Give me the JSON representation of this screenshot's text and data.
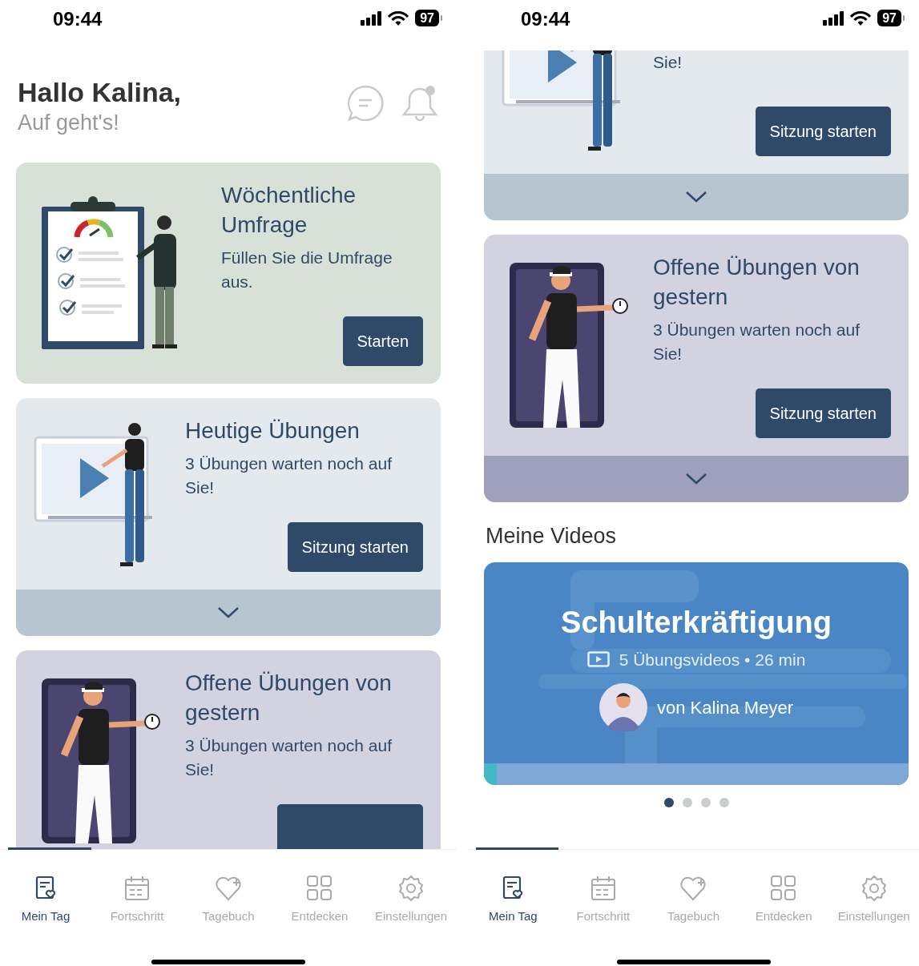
{
  "screens": [
    {
      "status_bar": {
        "time": "09:44",
        "battery": "97"
      },
      "greeting": {
        "title": "Hallo Kalina,",
        "subtitle": "Auf geht's!"
      },
      "cards": [
        {
          "kind": "survey",
          "title": "Wöchentliche Umfrage",
          "text": "Füllen Sie die Umfrage aus.",
          "button": "Starten",
          "expandable": false
        },
        {
          "kind": "today",
          "title": "Heutige Übungen",
          "text": "3 Übungen warten noch auf Sie!",
          "button": "Sitzung starten",
          "expandable": true
        },
        {
          "kind": "open",
          "title": "Offene Übungen von gestern",
          "text": "3 Übungen warten noch auf Sie!",
          "button_cut": true,
          "expandable": false
        }
      ],
      "tabs": [
        {
          "label": "Mein Tag",
          "selected": true
        },
        {
          "label": "Fortschritt",
          "selected": false
        },
        {
          "label": "Tagebuch",
          "selected": false
        },
        {
          "label": "Entdecken",
          "selected": false
        },
        {
          "label": "Einstellungen",
          "selected": false
        }
      ]
    },
    {
      "status_bar": {
        "time": "09:44",
        "battery": "97"
      },
      "cards": [
        {
          "kind": "today",
          "cut_top": true,
          "text": "Sie!",
          "button": "Sitzung starten",
          "expandable": true
        },
        {
          "kind": "open",
          "title": "Offene Übungen von gestern",
          "text": "3 Übungen warten noch auf Sie!",
          "button": "Sitzung starten",
          "expandable": true
        }
      ],
      "section_title": "Meine Videos",
      "video": {
        "title": "Schulterkräftigung",
        "meta": "5 Übungsvideos • 26 min",
        "author": "von Kalina Meyer",
        "level": 0.03
      },
      "pages": [
        {
          "selected": true
        },
        {
          "selected": false
        },
        {
          "selected": false
        },
        {
          "selected": false
        }
      ],
      "tabs": [
        {
          "label": "Mein Tag",
          "selected": true
        },
        {
          "label": "Fortschritt",
          "selected": false
        },
        {
          "label": "Tagebuch",
          "selected": false
        },
        {
          "label": "Entdecken",
          "selected": false
        },
        {
          "label": "Einstellungen",
          "selected": false
        }
      ]
    }
  ]
}
